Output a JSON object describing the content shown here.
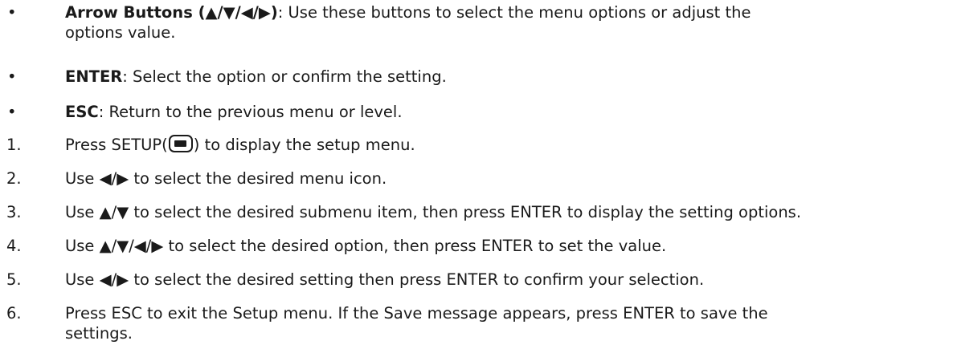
{
  "bullets": [
    {
      "marker": "•",
      "term": "Arrow Buttons (▲/▼/◀/▶)",
      "text_line1": ": Use these buttons to select the menu options or adjust the",
      "text_line2": "options value."
    },
    {
      "marker": "•",
      "term": "ENTER",
      "text": ": Select the option or confirm the setting."
    },
    {
      "marker": "•",
      "term": "ESC",
      "text": ": Return to the previous menu or level."
    }
  ],
  "steps": [
    {
      "number": "1.",
      "text_before": "Press SETUP(",
      "icon": "setup-button-icon",
      "text_after": ") to display the setup menu."
    },
    {
      "number": "2.",
      "text": "Use ◀/▶ to select the desired menu icon."
    },
    {
      "number": "3.",
      "text": "Use ▲/▼ to select the desired submenu item, then press ENTER to display the setting options."
    },
    {
      "number": "4.",
      "text": "Use ▲/▼/◀/▶ to select the desired option, then press ENTER to set the value."
    },
    {
      "number": "5.",
      "text": "Use ◀/▶ to select the desired setting then press ENTER to confirm your selection."
    },
    {
      "number": "6.",
      "text_line1": "Press ESC to exit the Setup menu. If the Save message appears, press ENTER to save the",
      "text_line2": "settings."
    }
  ]
}
